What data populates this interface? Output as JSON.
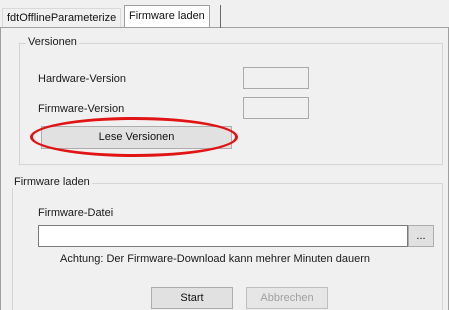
{
  "tabs": {
    "inactive_label": "fdtOfflineParameterize",
    "active_label": "Firmware laden"
  },
  "versionen": {
    "legend": "Versionen",
    "hardware_label": "Hardware-Version",
    "hardware_value": "",
    "firmware_label": "Firmware-Version",
    "firmware_value": "",
    "read_button": "Lese Versionen"
  },
  "firmware": {
    "legend": "Firmware laden",
    "file_label": "Firmware-Datei",
    "file_value": "",
    "browse_button": "...",
    "note": "Achtung: Der Firmware-Download kann mehrer Minuten dauern",
    "start_button": "Start",
    "cancel_button": "Abbrechen"
  },
  "colors": {
    "highlight": "#e01414"
  }
}
